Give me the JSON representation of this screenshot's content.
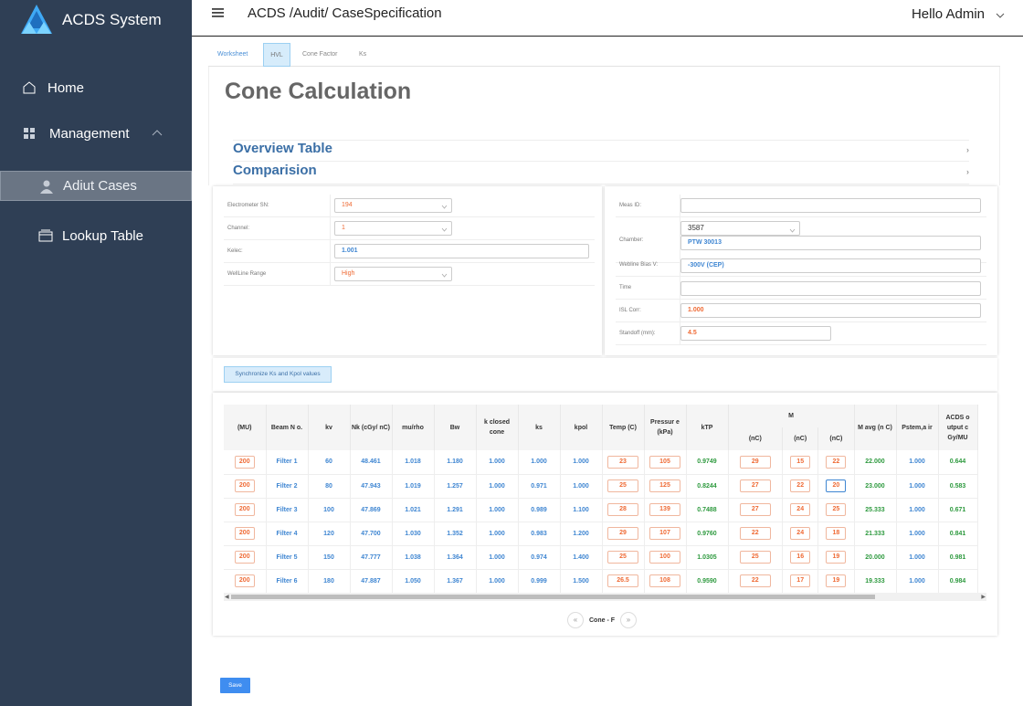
{
  "app": {
    "title": "ACDS System"
  },
  "sidebar": {
    "home": "Home",
    "management": "Management",
    "audit_cases": "Adiut Cases",
    "lookup": "Lookup Table"
  },
  "header": {
    "breadcrumb": "ACDS /Audit/ CaseSpecification",
    "user": "Hello Admin"
  },
  "tabs": [
    "Worksheet",
    "HVL",
    "Cone Factor",
    "Ks"
  ],
  "page_title": "Cone Calculation",
  "sections": [
    "Overview Table",
    "Comparision"
  ],
  "left_form": {
    "electrometer_label": "Electrometer SN:",
    "electrometer_value": "194",
    "channel_label": "Channel:",
    "channel_value": "1",
    "kelec_label": "Kelec:",
    "kelec_value": "1.001",
    "wellrange_label": "WellLine Range",
    "wellrange_value": "High"
  },
  "right_form": {
    "measid_label": "Meas ID:",
    "measid_value": "",
    "chamber_label": "Chamber:",
    "chamber_value": "3587",
    "chamber_model": "PTW 30013",
    "bias_label": "Webline Bias V:",
    "bias_value": "-300V (CEP)",
    "time_label": "Time",
    "time_value": "",
    "isl_label": "ISL Corr:",
    "isl_value": "1.000",
    "standoff_label": "Standoff (mm):",
    "standoff_value": "4.5"
  },
  "sync_button": "Synchronize Ks and Kpol values",
  "table": {
    "headers": {
      "mu": "(MU)",
      "beam": "Beam N o.",
      "kv": "kv",
      "nk": "Nk (cGy/ nC)",
      "murho": "mu/rho",
      "bw": "Bw",
      "kclosed": "k closed cone",
      "ks": "ks",
      "kpol": "kpol",
      "temp": "Temp (C)",
      "press": "Pressur e (kPa)",
      "ktp": "kTP",
      "m": "M",
      "m1": "(nC)",
      "m2": "(nC)",
      "m3": "(nC)",
      "mavg": "M avg (n C)",
      "pstem": "Pstem,a ir",
      "acds": "ACDS o utput c Gy/MU"
    },
    "rows": [
      {
        "mu": "200",
        "beam": "Filter 1",
        "kv": "60",
        "nk": "48.461",
        "murho": "1.018",
        "bw": "1.180",
        "kc": "1.000",
        "ks": "1.000",
        "kpol": "1.000",
        "temp": "23",
        "press": "105",
        "ktp": "0.9749",
        "m1": "29",
        "m2": "15",
        "m3": "22",
        "mavg": "22.000",
        "pstem": "1.000",
        "acds": "0.644"
      },
      {
        "mu": "200",
        "beam": "Filter 2",
        "kv": "80",
        "nk": "47.943",
        "murho": "1.019",
        "bw": "1.257",
        "kc": "1.000",
        "ks": "0.971",
        "kpol": "1.000",
        "temp": "25",
        "press": "125",
        "ktp": "0.8244",
        "m1": "27",
        "m2": "22",
        "m3": "20",
        "mavg": "23.000",
        "pstem": "1.000",
        "acds": "0.583"
      },
      {
        "mu": "200",
        "beam": "Filter 3",
        "kv": "100",
        "nk": "47.869",
        "murho": "1.021",
        "bw": "1.291",
        "kc": "1.000",
        "ks": "0.989",
        "kpol": "1.100",
        "temp": "28",
        "press": "139",
        "ktp": "0.7488",
        "m1": "27",
        "m2": "24",
        "m3": "25",
        "mavg": "25.333",
        "pstem": "1.000",
        "acds": "0.671"
      },
      {
        "mu": "200",
        "beam": "Filter 4",
        "kv": "120",
        "nk": "47.700",
        "murho": "1.030",
        "bw": "1.352",
        "kc": "1.000",
        "ks": "0.983",
        "kpol": "1.200",
        "temp": "29",
        "press": "107",
        "ktp": "0.9760",
        "m1": "22",
        "m2": "24",
        "m3": "18",
        "mavg": "21.333",
        "pstem": "1.000",
        "acds": "0.841"
      },
      {
        "mu": "200",
        "beam": "Filter 5",
        "kv": "150",
        "nk": "47.777",
        "murho": "1.038",
        "bw": "1.364",
        "kc": "1.000",
        "ks": "0.974",
        "kpol": "1.400",
        "temp": "25",
        "press": "100",
        "ktp": "1.0305",
        "m1": "25",
        "m2": "16",
        "m3": "19",
        "mavg": "20.000",
        "pstem": "1.000",
        "acds": "0.981"
      },
      {
        "mu": "200",
        "beam": "Filter 6",
        "kv": "180",
        "nk": "47.887",
        "murho": "1.050",
        "bw": "1.367",
        "kc": "1.000",
        "ks": "0.999",
        "kpol": "1.500",
        "temp": "26.5",
        "press": "108",
        "ktp": "0.9590",
        "m1": "22",
        "m2": "17",
        "m3": "19",
        "mavg": "19.333",
        "pstem": "1.000",
        "acds": "0.984"
      }
    ]
  },
  "pager": {
    "label": "Cone - F"
  },
  "save_button": "Save"
}
